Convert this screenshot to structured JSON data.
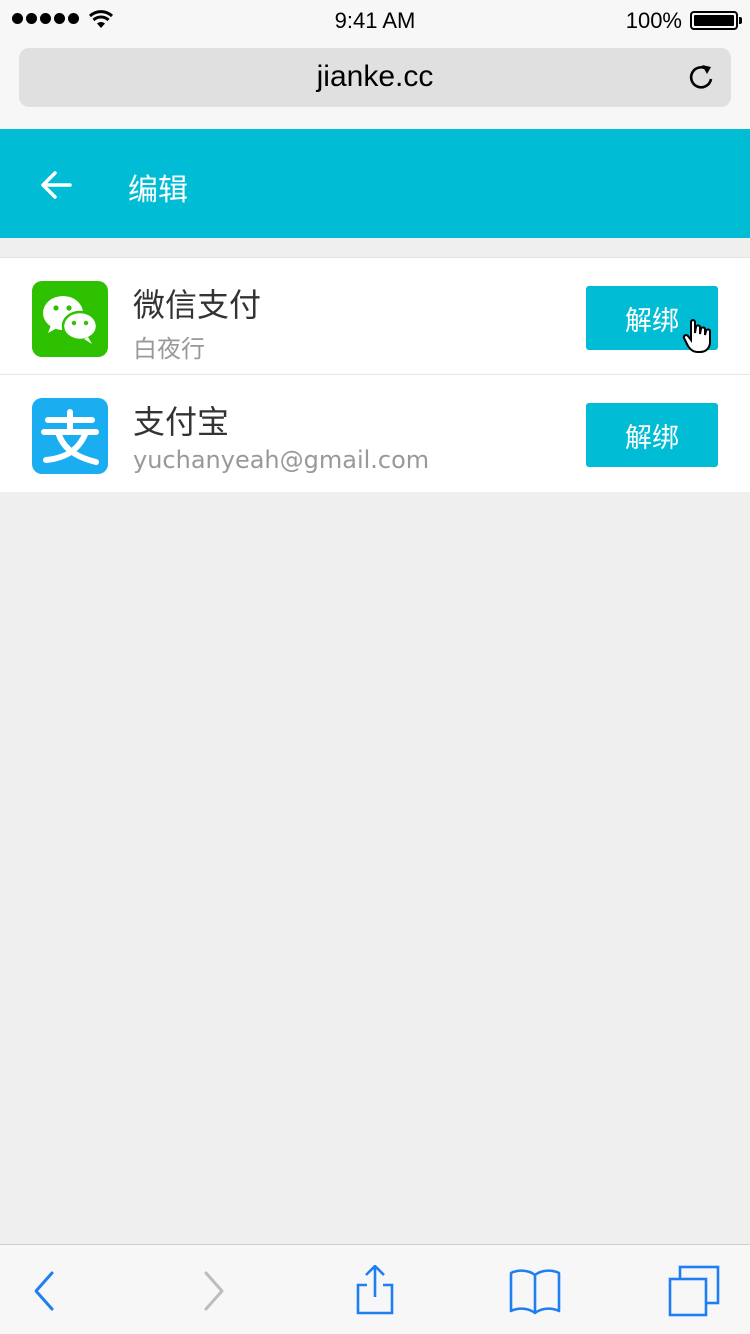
{
  "status_bar": {
    "time": "9:41 AM",
    "battery": "100%",
    "icons": [
      "signal-icon",
      "wifi-icon",
      "battery-icon"
    ]
  },
  "browser": {
    "url": "jianke.cc",
    "icons": [
      "reload-icon"
    ]
  },
  "header": {
    "title": "编辑",
    "icons": [
      "back-arrow-icon"
    ],
    "color": "#00bcd4"
  },
  "accounts": [
    {
      "title": "微信支付",
      "subtitle": "白夜行",
      "button": "解绑",
      "icon": "wechat-icon",
      "icon_color": "#2dc100"
    },
    {
      "title": "支付宝",
      "subtitle": "yuchanyeah@gmail.com",
      "button": "解绑",
      "icon": "alipay-icon",
      "icon_color": "#1aaef0"
    }
  ],
  "toolbar": {
    "icons": [
      "back-icon",
      "forward-icon",
      "share-icon",
      "bookmarks-icon",
      "tabs-icon"
    ],
    "accent": "#1f7ef2"
  }
}
